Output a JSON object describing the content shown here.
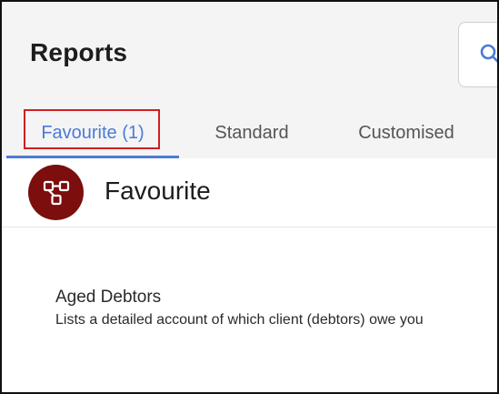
{
  "page": {
    "title": "Reports"
  },
  "tabs": [
    {
      "label": "Favourite (1)",
      "active": true
    },
    {
      "label": "Standard",
      "active": false
    },
    {
      "label": "Customised",
      "active": false
    }
  ],
  "section": {
    "title": "Favourite",
    "icon": "hierarchy-icon"
  },
  "reports": [
    {
      "name": "Aged Debtors",
      "description": "Lists a detailed account of which client (debtors) owe you"
    }
  ],
  "icons": {
    "search": "search-icon"
  },
  "colors": {
    "accent": "#4a7bd6",
    "highlight": "#d11f1f",
    "section_icon_bg": "#7c0e0e"
  }
}
